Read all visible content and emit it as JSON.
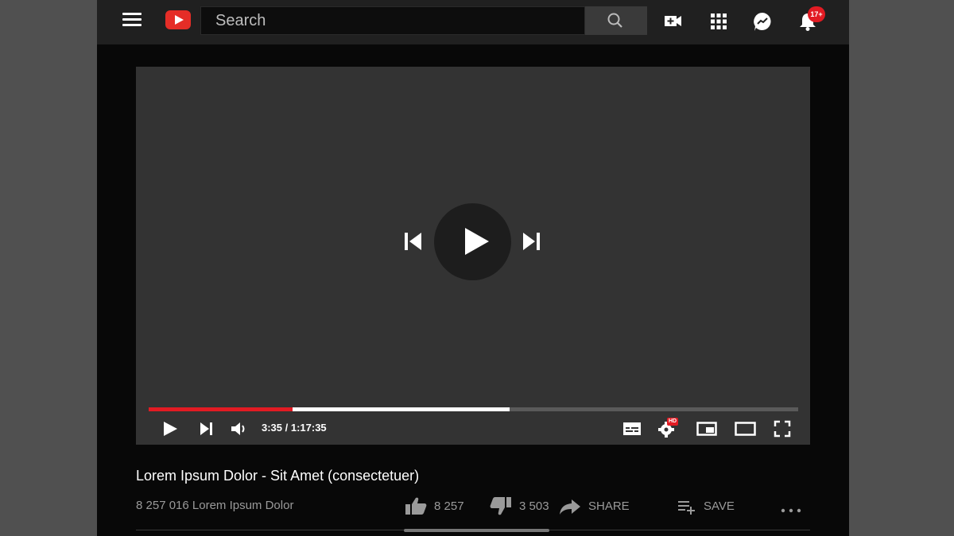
{
  "header": {
    "search_placeholder": "Search",
    "notifications_badge": "17+",
    "icons": [
      "menu-icon",
      "youtube-logo",
      "search-icon",
      "create-video-icon",
      "apps-icon",
      "messages-icon",
      "bell-icon"
    ]
  },
  "player": {
    "current_time": "3:35",
    "duration": "1:17:35",
    "time_display": "3:35 / 1:17:35",
    "played_fraction": 0.222,
    "buffered_fraction": 0.556,
    "quality_badge": "HD",
    "colors": {
      "accent": "#e21b23",
      "player_bg": "#333333"
    }
  },
  "video": {
    "title": "Lorem Ipsum Dolor - Sit Amet (consectetuer)",
    "views": "8 257 016 Lorem Ipsum Dolor",
    "likes": "8 257",
    "dislikes": "3 503",
    "share_label": "SHARE",
    "save_label": "SAVE"
  }
}
